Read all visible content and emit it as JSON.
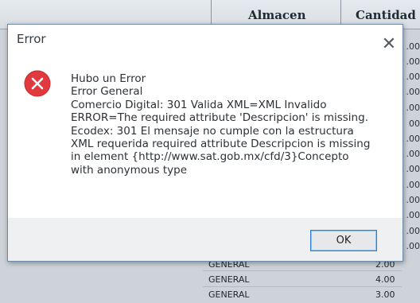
{
  "background_table": {
    "headers": [
      "Almacen",
      "Cantidad"
    ],
    "right_numbers": [
      ".00",
      ".00",
      ".00",
      ".00",
      ".00",
      "00",
      ".00",
      ".00",
      ".00",
      ".00",
      ".00",
      ".00",
      ".00",
      ".00"
    ],
    "rows": [
      {
        "almacen": "GENERAL",
        "cantidad": "2.00"
      },
      {
        "almacen": "GENERAL",
        "cantidad": "4.00"
      },
      {
        "almacen": "GENERAL",
        "cantidad": "3.00"
      }
    ]
  },
  "dialog": {
    "title": "Error",
    "close_glyph": "✕",
    "icon": "error-icon",
    "message_lines": [
      "Hubo un Error",
      "Error General",
      "Comercio Digital: 301  Valida XML=XML Invalido",
      "ERROR=The required attribute 'Descripcion' is missing.",
      "Ecodex: 301 El mensaje no cumple con la estructura",
      "XML requerida required attribute Descripcion is missing",
      "in element {http://www.sat.gob.mx/cfd/3}Concepto",
      "with anonymous type"
    ],
    "ok_label": "OK"
  },
  "colors": {
    "error_red": "#e0393e",
    "accent_blue": "#2e7fcf"
  }
}
